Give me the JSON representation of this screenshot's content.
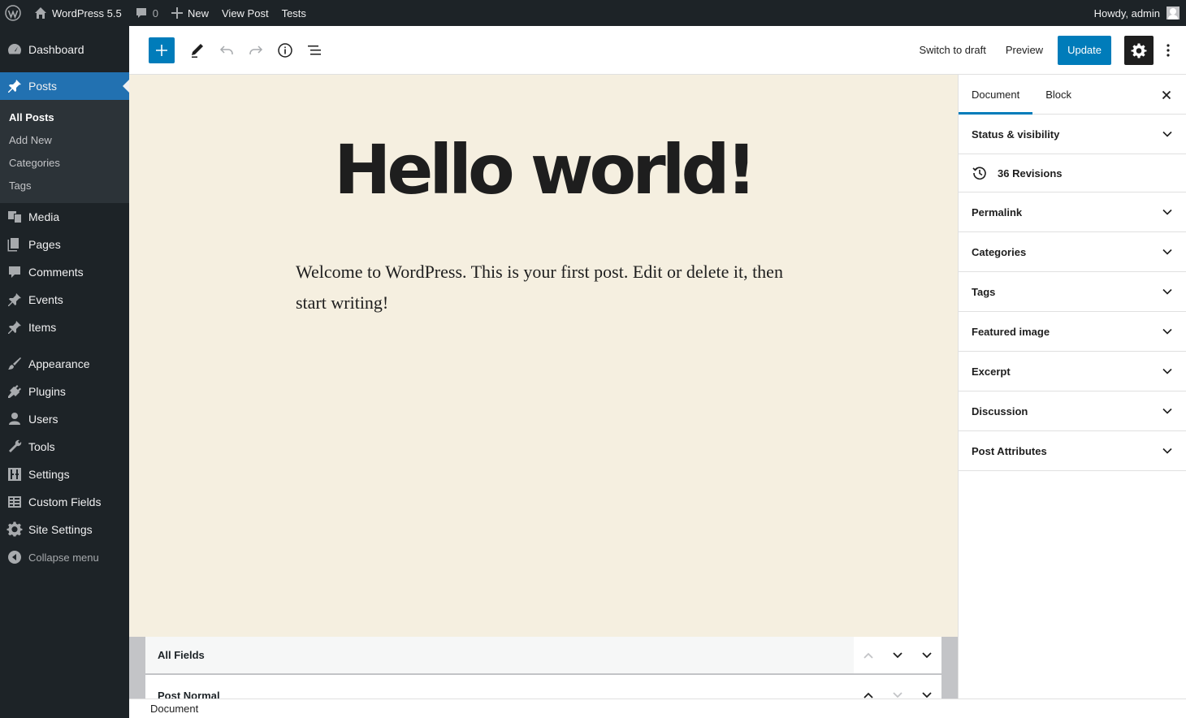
{
  "admin_bar": {
    "site_name": "WordPress 5.5",
    "comments_count": "0",
    "new_label": "New",
    "view_post_label": "View Post",
    "tests_label": "Tests",
    "greeting": "Howdy, admin"
  },
  "sidebar": {
    "items": [
      {
        "label": "Dashboard",
        "icon": "dashboard-icon"
      },
      {
        "label": "Posts",
        "icon": "pin-icon"
      },
      {
        "label": "Media",
        "icon": "media-icon"
      },
      {
        "label": "Pages",
        "icon": "pages-icon"
      },
      {
        "label": "Comments",
        "icon": "comment-icon"
      },
      {
        "label": "Events",
        "icon": "pin-icon"
      },
      {
        "label": "Items",
        "icon": "pin-icon"
      },
      {
        "label": "Appearance",
        "icon": "brush-icon"
      },
      {
        "label": "Plugins",
        "icon": "plugin-icon"
      },
      {
        "label": "Users",
        "icon": "user-icon"
      },
      {
        "label": "Tools",
        "icon": "wrench-icon"
      },
      {
        "label": "Settings",
        "icon": "settings-icon"
      },
      {
        "label": "Custom Fields",
        "icon": "table-icon"
      },
      {
        "label": "Site Settings",
        "icon": "gear-icon"
      }
    ],
    "posts_submenu": [
      "All Posts",
      "Add New",
      "Categories",
      "Tags"
    ],
    "collapse_label": "Collapse menu"
  },
  "header": {
    "switch_to_draft": "Switch to draft",
    "preview": "Preview",
    "update": "Update"
  },
  "post": {
    "title": "Hello world!",
    "paragraph": "Welcome to WordPress. This is your first post. Edit or delete it, then start writing!"
  },
  "settings_panel": {
    "tabs": [
      "Document",
      "Block"
    ],
    "revisions": "36 Revisions",
    "panels": [
      "Status & visibility",
      "Permalink",
      "Categories",
      "Tags",
      "Featured image",
      "Excerpt",
      "Discussion",
      "Post Attributes"
    ]
  },
  "meta_boxes": [
    "All Fields",
    "Post Normal"
  ],
  "footer": {
    "breadcrumb": "Document"
  },
  "colors": {
    "accent": "#007cba",
    "admin_dark": "#1d2327",
    "canvas_bg": "#f5efe0"
  }
}
